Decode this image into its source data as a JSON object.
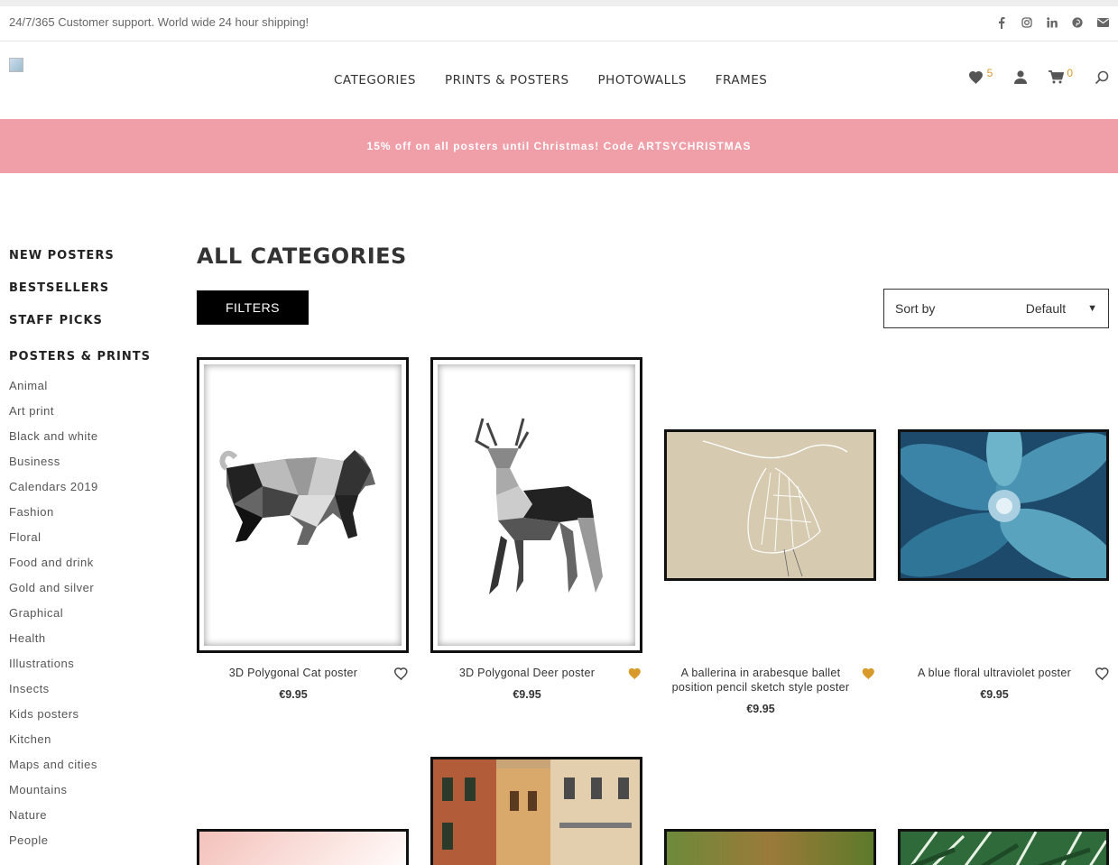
{
  "topbar": {
    "support_text": "24/7/365 Customer support. World wide 24 hour shipping!",
    "socials": [
      "facebook-icon",
      "instagram-icon",
      "linkedin-icon",
      "pinterest-icon",
      "mail-icon"
    ]
  },
  "header": {
    "nav": [
      "CATEGORIES",
      "PRINTS & POSTERS",
      "PHOTOWALLS",
      "FRAMES"
    ],
    "wishlist_count": "5",
    "cart_count": "0"
  },
  "banner": {
    "text": "15% off on all posters until Christmas! Code ARTSYCHRISTMAS"
  },
  "sidebar": {
    "main_links": [
      "NEW POSTERS",
      "BESTSELLERS",
      "STAFF PICKS"
    ],
    "section_title": "POSTERS & PRINTS",
    "categories": [
      "Animal",
      "Art print",
      "Black and white",
      "Business",
      "Calendars 2019",
      "Fashion",
      "Floral",
      "Food and drink",
      "Gold and silver",
      "Graphical",
      "Health",
      "Illustrations",
      "Insects",
      "Kids posters",
      "Kitchen",
      "Maps and cities",
      "Mountains",
      "Nature",
      "People"
    ]
  },
  "main": {
    "title": "ALL CATEGORIES",
    "filters_label": "FILTERS",
    "sort_label": "Sort by",
    "sort_value": "Default"
  },
  "products": [
    {
      "name": "3D Polygonal Cat poster",
      "price": "€9.95",
      "wishlisted": false
    },
    {
      "name": "3D Polygonal Deer poster",
      "price": "€9.95",
      "wishlisted": true
    },
    {
      "name": "A ballerina in arabesque ballet position pencil sketch style poster",
      "price": "€9.95",
      "wishlisted": true
    },
    {
      "name": "A blue floral ultraviolet poster",
      "price": "€9.95",
      "wishlisted": false
    }
  ],
  "colors": {
    "banner": "#f09ea8",
    "accent": "#d89a2b",
    "button": "#000000"
  }
}
